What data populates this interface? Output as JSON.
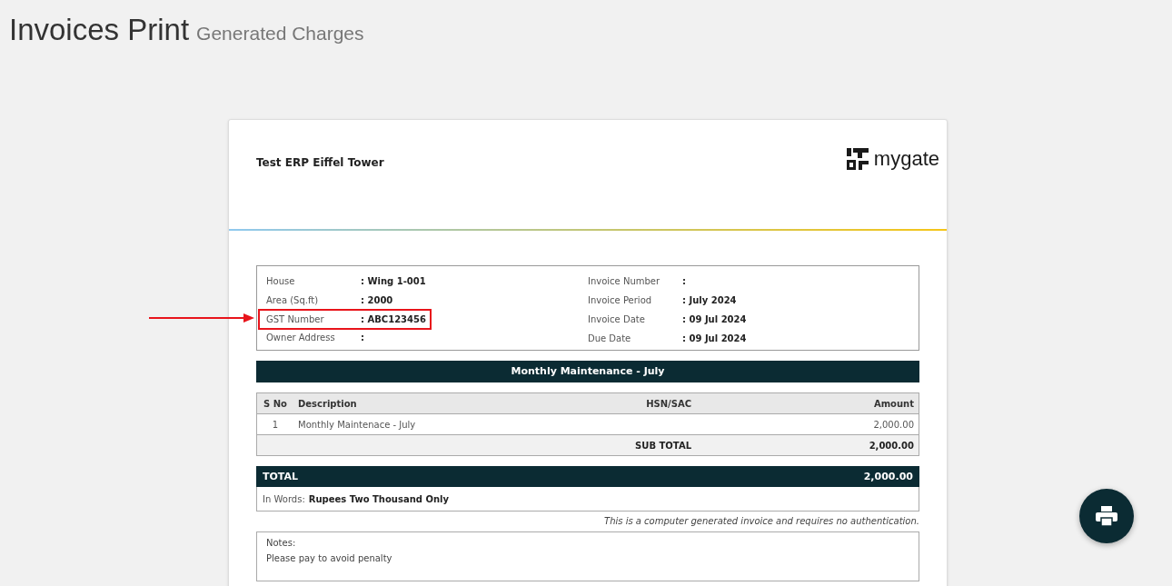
{
  "page": {
    "title": "Invoices Print",
    "subtitle": "Generated Charges"
  },
  "invoice": {
    "society": "Test ERP Eiffel Tower",
    "logo_text": "mygate",
    "info_left": [
      {
        "label": "House",
        "value": ": Wing 1-001",
        "highlighted": false
      },
      {
        "label": "Area (Sq.ft)",
        "value": ": 2000",
        "highlighted": false
      },
      {
        "label": "GST Number",
        "value": ": ABC123456",
        "highlighted": true
      },
      {
        "label": "Owner Address",
        "value": ":",
        "highlighted": false
      }
    ],
    "info_right": [
      {
        "label": "Invoice Number",
        "value": ":"
      },
      {
        "label": "Invoice Period",
        "value": ": July 2024"
      },
      {
        "label": "Invoice Date",
        "value": ": 09 Jul 2024"
      },
      {
        "label": "Due Date",
        "value": ": 09 Jul 2024"
      }
    ],
    "section_title": "Monthly Maintenance - July",
    "table": {
      "columns": [
        "S No",
        "Description",
        "HSN/SAC",
        "Amount"
      ],
      "rows": [
        [
          "1",
          "Monthly Maintenace - July",
          "",
          "2,000.00"
        ]
      ],
      "subtotal_label": "SUB TOTAL",
      "subtotal": "2,000.00"
    },
    "total_label": "TOTAL",
    "total": "2,000.00",
    "words_label": "In Words:",
    "words": "Rupees Two Thousand Only",
    "disclaimer": "This is a computer generated invoice and requires no authentication.",
    "notes_label": "Notes:",
    "notes": "Please pay to avoid penalty"
  }
}
